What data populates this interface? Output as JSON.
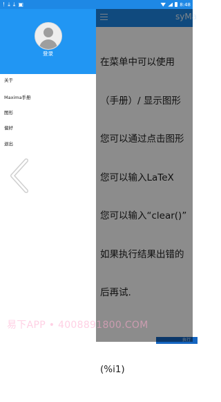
{
  "status_bar": {
    "time": "8:48",
    "left_icons": [
      "alert-icon",
      "download-icon",
      "download-icon",
      "sim-icon"
    ]
  },
  "toolbar": {
    "title": "syMa"
  },
  "output": {
    "lines": [
      "在菜单中可以使用",
      "（手册）/ 显示图形",
      "您可以通过点击图形",
      "您可以输入LaTeX",
      "您可以输入“clear()”",
      "如果执行结果出错的",
      "后再试.",
      "",
      "(%i1)"
    ]
  },
  "bottom_button": {
    "label": "执行"
  },
  "drawer": {
    "login_label": "登录",
    "items": [
      {
        "label": "关于"
      },
      {
        "label": "Maxima手册"
      },
      {
        "label": "图形"
      },
      {
        "label": "偏好"
      },
      {
        "label": "退出"
      }
    ]
  },
  "watermark": "易下APP • 4008891800.COM",
  "colors": {
    "primary": "#2196f3",
    "status_bar": "#1e88e5",
    "scrim": "rgba(0,0,0,0.45)"
  }
}
